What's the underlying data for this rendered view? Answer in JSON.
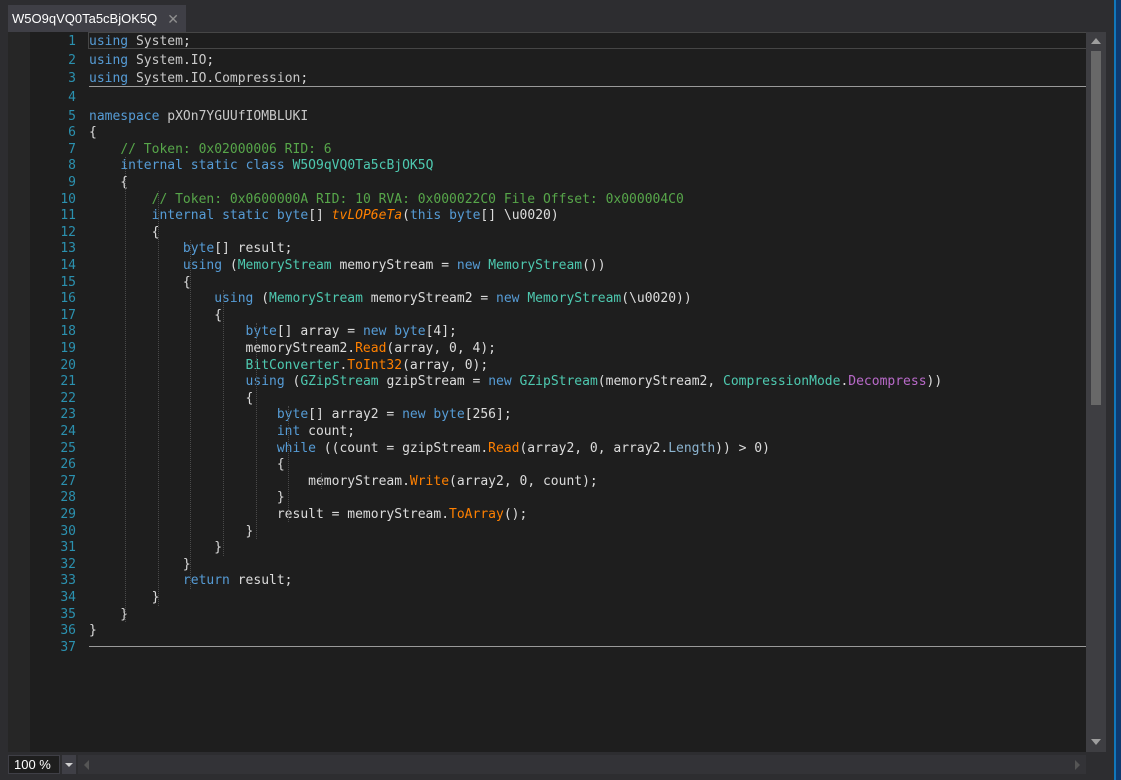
{
  "tab": {
    "title": "W5O9qVQ0Ta5cBjOK5Q",
    "close": "✕"
  },
  "status": {
    "zoom": "100 %"
  },
  "icons": {
    "close": "close-icon",
    "dropdown": "chevron-down-icon",
    "scroll_up": "arrow-up-icon",
    "scroll_down": "arrow-down-icon"
  },
  "colors": {
    "keyword": "#569cd6",
    "type": "#4ec9b0",
    "comment": "#57a64a",
    "method": "#ff8000",
    "line_number": "#2b91af",
    "background": "#1e1e1e"
  },
  "code": {
    "line_numbers": [
      "1",
      "2",
      "3",
      "4",
      "5",
      "6",
      "7",
      "8",
      "9",
      "10",
      "11",
      "12",
      "13",
      "14",
      "15",
      "16",
      "17",
      "18",
      "19",
      "20",
      "21",
      "22",
      "23",
      "24",
      "25",
      "26",
      "27",
      "28",
      "29",
      "30",
      "31",
      "32",
      "33",
      "34",
      "35",
      "36",
      "37"
    ],
    "lines": [
      [
        {
          "t": "using",
          "c": "kw"
        },
        {
          "t": " "
        },
        {
          "t": "System",
          "c": "ns"
        },
        {
          "t": ";"
        }
      ],
      [
        {
          "t": "using",
          "c": "kw"
        },
        {
          "t": " "
        },
        {
          "t": "System",
          "c": "ns"
        },
        {
          "t": "."
        },
        {
          "t": "IO",
          "c": "ns"
        },
        {
          "t": ";"
        }
      ],
      [
        {
          "t": "using",
          "c": "kw"
        },
        {
          "t": " "
        },
        {
          "t": "System",
          "c": "ns"
        },
        {
          "t": "."
        },
        {
          "t": "IO",
          "c": "ns"
        },
        {
          "t": "."
        },
        {
          "t": "Compression",
          "c": "ns"
        },
        {
          "t": ";"
        }
      ],
      [],
      [
        {
          "t": "namespace",
          "c": "kw"
        },
        {
          "t": " "
        },
        {
          "t": "pXOn7YGUUfIOMBLUKI",
          "c": "ns"
        }
      ],
      [
        {
          "t": "{"
        }
      ],
      [
        {
          "t": "    "
        },
        {
          "t": "// Token: 0x02000006 RID: 6",
          "c": "cm"
        }
      ],
      [
        {
          "t": "    "
        },
        {
          "t": "internal",
          "c": "kw"
        },
        {
          "t": " "
        },
        {
          "t": "static",
          "c": "kw"
        },
        {
          "t": " "
        },
        {
          "t": "class",
          "c": "kw"
        },
        {
          "t": " "
        },
        {
          "t": "W5O9qVQ0Ta5cBjOK5Q",
          "c": "cls"
        }
      ],
      [
        {
          "t": "    {"
        }
      ],
      [
        {
          "t": "        "
        },
        {
          "t": "// Token: 0x0600000A RID: 10 RVA: 0x000022C0 File Offset: 0x000004C0",
          "c": "cm"
        }
      ],
      [
        {
          "t": "        "
        },
        {
          "t": "internal",
          "c": "kw"
        },
        {
          "t": " "
        },
        {
          "t": "static",
          "c": "kw"
        },
        {
          "t": " "
        },
        {
          "t": "byte",
          "c": "kw"
        },
        {
          "t": "[] "
        },
        {
          "t": "tvLOP6eTa",
          "c": "mi"
        },
        {
          "t": "("
        },
        {
          "t": "this",
          "c": "kw"
        },
        {
          "t": " "
        },
        {
          "t": "byte",
          "c": "kw"
        },
        {
          "t": "[] \\u0020)"
        }
      ],
      [
        {
          "t": "        {"
        }
      ],
      [
        {
          "t": "            "
        },
        {
          "t": "byte",
          "c": "kw"
        },
        {
          "t": "[] result;"
        }
      ],
      [
        {
          "t": "            "
        },
        {
          "t": "using",
          "c": "kw"
        },
        {
          "t": " ("
        },
        {
          "t": "MemoryStream",
          "c": "ty"
        },
        {
          "t": " memoryStream = "
        },
        {
          "t": "new",
          "c": "kw"
        },
        {
          "t": " "
        },
        {
          "t": "MemoryStream",
          "c": "ty"
        },
        {
          "t": "())"
        }
      ],
      [
        {
          "t": "            {"
        }
      ],
      [
        {
          "t": "                "
        },
        {
          "t": "using",
          "c": "kw"
        },
        {
          "t": " ("
        },
        {
          "t": "MemoryStream",
          "c": "ty"
        },
        {
          "t": " memoryStream2 = "
        },
        {
          "t": "new",
          "c": "kw"
        },
        {
          "t": " "
        },
        {
          "t": "MemoryStream",
          "c": "ty"
        },
        {
          "t": "(\\u0020))"
        }
      ],
      [
        {
          "t": "                {"
        }
      ],
      [
        {
          "t": "                    "
        },
        {
          "t": "byte",
          "c": "kw"
        },
        {
          "t": "[] array = "
        },
        {
          "t": "new",
          "c": "kw"
        },
        {
          "t": " "
        },
        {
          "t": "byte",
          "c": "kw"
        },
        {
          "t": "[4];"
        }
      ],
      [
        {
          "t": "                    memoryStream2."
        },
        {
          "t": "Read",
          "c": "mt"
        },
        {
          "t": "(array, 0, 4);"
        }
      ],
      [
        {
          "t": "                    "
        },
        {
          "t": "BitConverter",
          "c": "ty"
        },
        {
          "t": "."
        },
        {
          "t": "ToInt32",
          "c": "mt"
        },
        {
          "t": "(array, 0);"
        }
      ],
      [
        {
          "t": "                    "
        },
        {
          "t": "using",
          "c": "kw"
        },
        {
          "t": " ("
        },
        {
          "t": "GZipStream",
          "c": "ty"
        },
        {
          "t": " gzipStream = "
        },
        {
          "t": "new",
          "c": "kw"
        },
        {
          "t": " "
        },
        {
          "t": "GZipStream",
          "c": "ty"
        },
        {
          "t": "(memoryStream2, "
        },
        {
          "t": "CompressionMode",
          "c": "ty"
        },
        {
          "t": "."
        },
        {
          "t": "Decompress",
          "c": "em"
        },
        {
          "t": "))"
        }
      ],
      [
        {
          "t": "                    {"
        }
      ],
      [
        {
          "t": "                        "
        },
        {
          "t": "byte",
          "c": "kw"
        },
        {
          "t": "[] array2 = "
        },
        {
          "t": "new",
          "c": "kw"
        },
        {
          "t": " "
        },
        {
          "t": "byte",
          "c": "kw"
        },
        {
          "t": "[256];"
        }
      ],
      [
        {
          "t": "                        "
        },
        {
          "t": "int",
          "c": "kw"
        },
        {
          "t": " count;"
        }
      ],
      [
        {
          "t": "                        "
        },
        {
          "t": "while",
          "c": "kw"
        },
        {
          "t": " ((count = gzipStream."
        },
        {
          "t": "Read",
          "c": "mt"
        },
        {
          "t": "(array2, 0, array2."
        },
        {
          "t": "Length",
          "c": "pr"
        },
        {
          "t": ")) > 0)"
        }
      ],
      [
        {
          "t": "                        {"
        }
      ],
      [
        {
          "t": "                            memoryStream."
        },
        {
          "t": "Write",
          "c": "mt"
        },
        {
          "t": "(array2, 0, count);"
        }
      ],
      [
        {
          "t": "                        }"
        }
      ],
      [
        {
          "t": "                        result = memoryStream."
        },
        {
          "t": "ToArray",
          "c": "mt"
        },
        {
          "t": "();"
        }
      ],
      [
        {
          "t": "                    }"
        }
      ],
      [
        {
          "t": "                }"
        }
      ],
      [
        {
          "t": "            }"
        }
      ],
      [
        {
          "t": "            "
        },
        {
          "t": "return",
          "c": "kw"
        },
        {
          "t": " result;"
        }
      ],
      [
        {
          "t": "        }"
        }
      ],
      [
        {
          "t": "    }"
        }
      ],
      [
        {
          "t": "}"
        }
      ],
      []
    ]
  }
}
